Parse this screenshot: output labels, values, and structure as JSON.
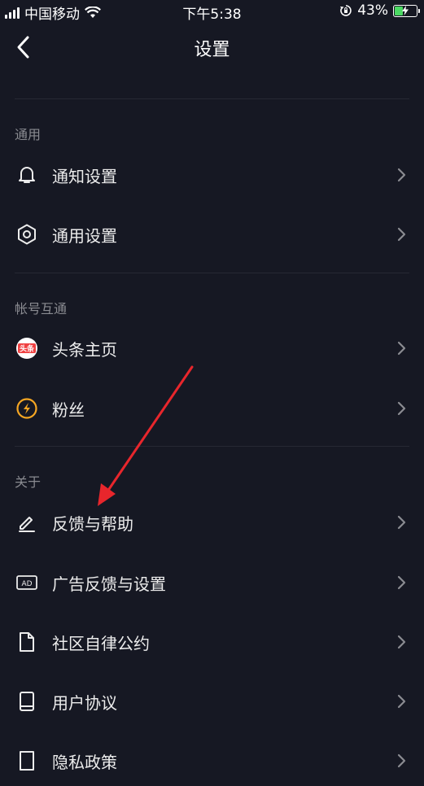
{
  "status_bar": {
    "carrier": "中国移动",
    "time": "下午5:38",
    "battery": "43%",
    "battery_level": 0.43
  },
  "nav": {
    "title": "设置"
  },
  "sections": {
    "general": {
      "header": "通用",
      "items": [
        "通知设置",
        "通用设置"
      ]
    },
    "accounts": {
      "header": "帐号互通",
      "items": [
        "头条主页",
        "粉丝"
      ],
      "toutiao_badge": "头条"
    },
    "about": {
      "header": "关于",
      "items": [
        "反馈与帮助",
        "广告反馈与设置",
        "社区自律公约",
        "用户协议",
        "隐私政策"
      ],
      "ad_badge": "AD"
    }
  },
  "colors": {
    "background": "#161823",
    "toutiao_red": "#f04142",
    "fans_orange": "#f5a623",
    "annotation_arrow": "#e8262c"
  },
  "icons": [
    "bell-icon",
    "gear-icon",
    "toutiao-icon",
    "fans-icon",
    "edit-icon",
    "ad-icon",
    "document-icon",
    "book-icon",
    "privacy-icon",
    "chevron-right-icon"
  ]
}
